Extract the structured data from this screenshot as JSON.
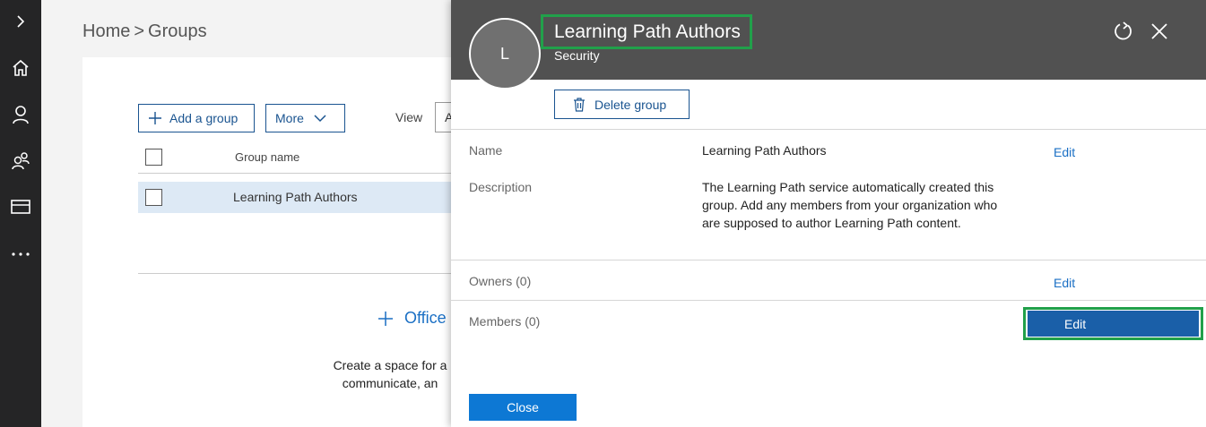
{
  "breadcrumb": {
    "home": "Home",
    "separator": ">",
    "current": "Groups"
  },
  "toolbar": {
    "add_group_label": "Add a group",
    "more_label": "More",
    "view_label": "View",
    "view_value": "A"
  },
  "table": {
    "column_header": "Group name",
    "rows": [
      {
        "name": "Learning Path Authors"
      }
    ]
  },
  "empty_state": {
    "link_text": "Office",
    "description_lines": [
      "Create a space for a",
      "communicate, an"
    ]
  },
  "panel": {
    "avatar_initial": "L",
    "title": "Learning Path Authors",
    "subtitle": "Security",
    "delete_label": "Delete group",
    "fields": {
      "name_label": "Name",
      "name_value": "Learning Path Authors",
      "description_label": "Description",
      "description_value": "The Learning Path service automatically created this group. Add any members from your organization who are supposed to author Learning Path content.",
      "owners_label": "Owners (0)",
      "members_label": "Members (0)"
    },
    "edit_label": "Edit",
    "close_label": "Close"
  },
  "colors": {
    "nav_rail": "#252526",
    "panel_header": "#515151",
    "accent": "#0d78d4",
    "highlight": "#21a04a"
  },
  "icons": [
    "chevron-right-icon",
    "home-icon",
    "person-icon",
    "people-icon",
    "card-icon",
    "more-icon",
    "plus-icon",
    "chevron-down-icon",
    "trash-icon",
    "refresh-icon",
    "close-icon"
  ]
}
